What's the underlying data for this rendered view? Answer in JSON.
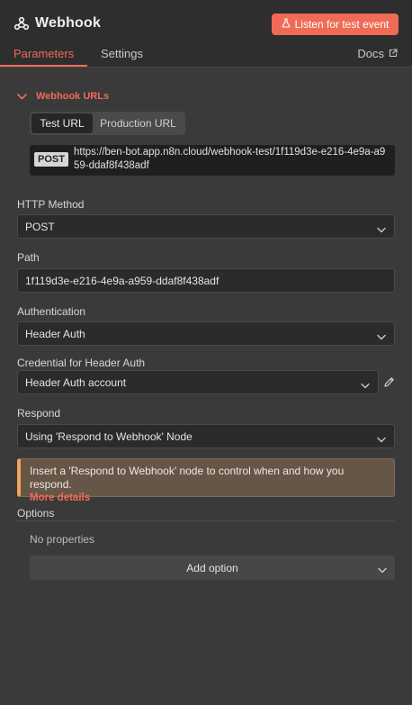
{
  "header": {
    "title": "Webhook",
    "title_icon": "webhook-icon",
    "listen_button": "Listen for test event",
    "listen_icon": "flask-icon"
  },
  "tabs": {
    "parameters": "Parameters",
    "settings": "Settings",
    "active": "parameters"
  },
  "docs": {
    "label": "Docs",
    "icon": "external-link-icon"
  },
  "webhook_urls": {
    "section_label": "Webhook URLs",
    "expanded": true,
    "switch": {
      "test": "Test URL",
      "production": "Production URL",
      "active": "test"
    },
    "method": "POST",
    "url": "https://ben-bot.app.n8n.cloud/webhook-test/1f119d3e-e216-4e9a-a959-ddaf8f438adf"
  },
  "fields": {
    "http_method": {
      "label": "HTTP Method",
      "value": "POST"
    },
    "path": {
      "label": "Path",
      "value": "1f119d3e-e216-4e9a-a959-ddaf8f438adf"
    },
    "authentication": {
      "label": "Authentication",
      "value": "Header Auth"
    },
    "credential": {
      "label": "Credential for Header Auth",
      "value": "Header Auth account"
    },
    "respond": {
      "label": "Respond",
      "value": "Using 'Respond to Webhook' Node"
    }
  },
  "notice": {
    "text": "Insert a 'Respond to Webhook' node to control when and how you respond.",
    "link": "More details"
  },
  "options": {
    "label": "Options",
    "empty_text": "No properties",
    "add_button": "Add option"
  },
  "colors": {
    "accent": "#f06b56",
    "panel_bg": "#3a3a3a",
    "header_bg": "#2e2e2e",
    "input_bg": "#2b2b2b",
    "notice_bg": "#665647",
    "notice_border": "#f0a55a"
  }
}
